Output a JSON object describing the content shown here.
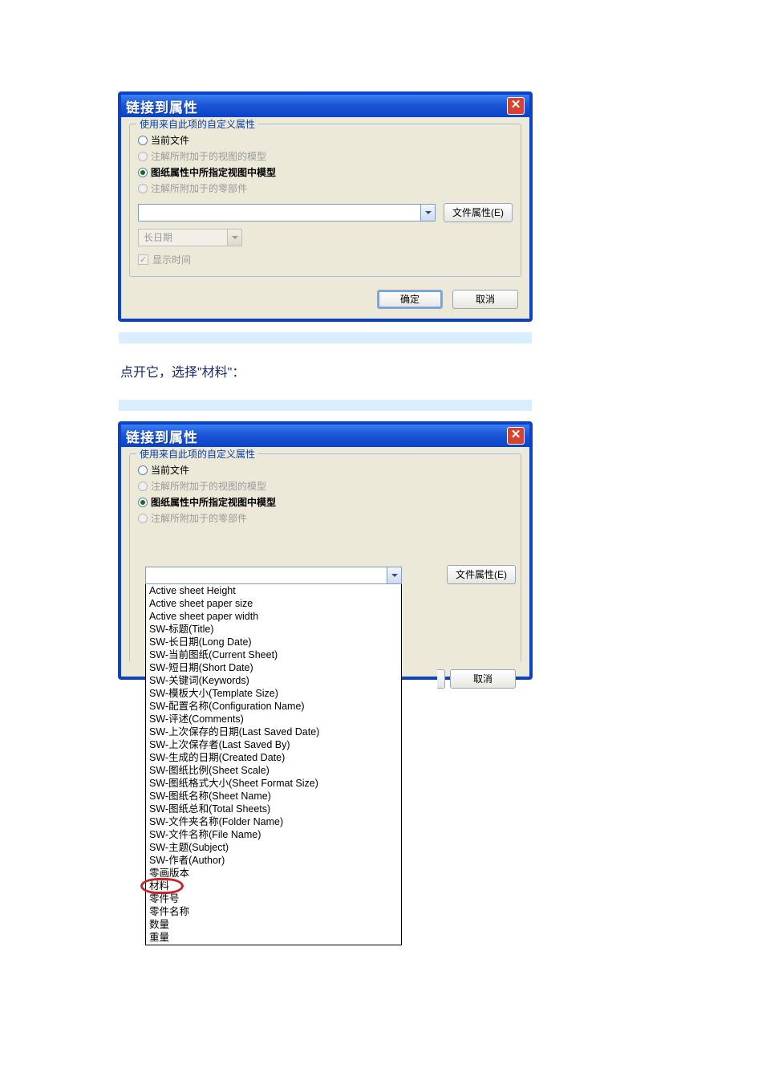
{
  "dialog_title": "链接到属性",
  "group_legend": "使用来自此项的自定义属性",
  "radios": {
    "r1": "当前文件",
    "r2": "注解所附加于的视图的模型",
    "r3": "图纸属性中所指定视图中模型",
    "r4": "注解所附加于的零部件"
  },
  "file_props_btn": "文件属性(E)",
  "date_label": "长日期",
  "show_time": "显示时间",
  "ok": "确定",
  "cancel": "取消",
  "caption_text": "点开它，选择\"材料\"：",
  "dropdown": {
    "items": [
      "Active sheet Height",
      "Active sheet paper size",
      "Active sheet paper width",
      "SW-标题(Title)",
      "SW-长日期(Long Date)",
      "SW-当前图纸(Current Sheet)",
      "SW-短日期(Short Date)",
      "SW-关键词(Keywords)",
      "SW-模板大小(Template Size)",
      "SW-配置名称(Configuration Name)",
      "SW-评述(Comments)",
      "SW-上次保存的日期(Last Saved Date)",
      "SW-上次保存者(Last Saved By)",
      "SW-生成的日期(Created Date)",
      "SW-图纸比例(Sheet Scale)",
      "SW-图纸格式大小(Sheet Format Size)",
      "SW-图纸名称(Sheet Name)",
      "SW-图纸总和(Total Sheets)",
      "SW-文件夹名称(Folder Name)",
      "SW-文件名称(File Name)",
      "SW-主题(Subject)",
      "SW-作者(Author)",
      "零画版本",
      "材料",
      "零件号",
      "零件名称",
      "数量",
      "重量"
    ],
    "highlighted": "材料"
  }
}
